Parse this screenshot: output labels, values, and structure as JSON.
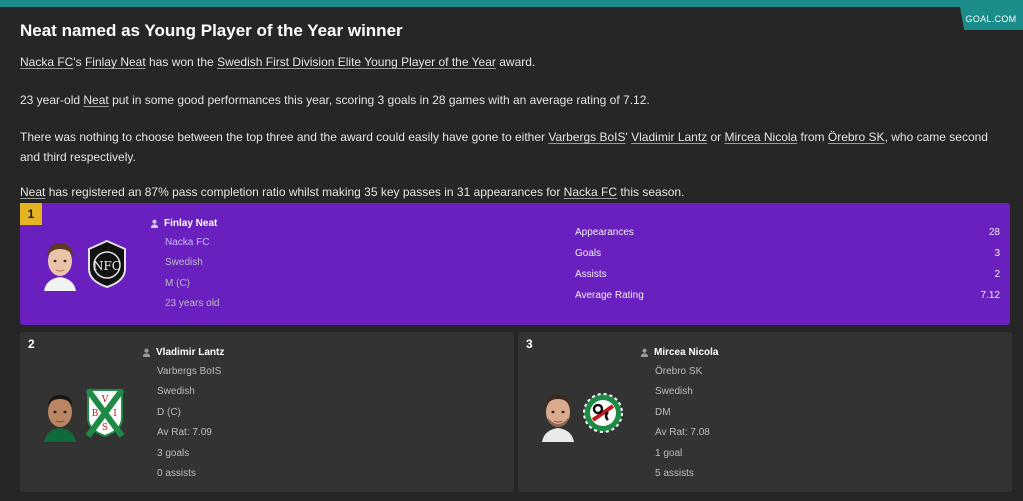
{
  "source_tab": "GOAL.COM",
  "headline": "Neat named as Young Player of the Year winner",
  "p1": {
    "club": "Nacka FC",
    "possessive": "'s ",
    "player": "Finlay Neat",
    "mid": " has won the ",
    "award": "Swedish First Division Elite Young Player of the Year",
    "end": " award."
  },
  "p2": {
    "start": "23 year-old ",
    "player": "Neat",
    "end": " put in some good performances this year, scoring 3 goals in 28 games with an average rating of 7.12."
  },
  "p3": {
    "start": "There was nothing to choose between the top three and the award could easily have gone to either ",
    "club2": "Varbergs BoIS",
    "apos": "' ",
    "player2": "Vladimir Lantz",
    "or": " or ",
    "player3": "Mircea Nicola",
    "from": " from ",
    "club3": "Örebro SK",
    "end": ", who came second and third respectively."
  },
  "p4": {
    "player": "Neat",
    "mid": " has registered an 87% pass completion ratio whilst making 35 key passes in 31 appearances for ",
    "club": "Nacka FC",
    "end": " this season."
  },
  "winner": {
    "rank": "1",
    "name": "Finlay Neat",
    "club": "Nacka FC",
    "nationality": "Swedish",
    "position": "M (C)",
    "age": "23 years old",
    "stats": [
      {
        "label": "Appearances",
        "value": "28"
      },
      {
        "label": "Goals",
        "value": "3"
      },
      {
        "label": "Assists",
        "value": "2"
      },
      {
        "label": "Average Rating",
        "value": "7.12"
      }
    ]
  },
  "second": {
    "rank": "2",
    "name": "Vladimir Lantz",
    "club": "Varbergs BoIS",
    "nationality": "Swedish",
    "position": "D (C)",
    "rating": "Av Rat: 7.09",
    "goals": "3 goals",
    "assists": "0 assists"
  },
  "third": {
    "rank": "3",
    "name": "Mircea Nicola",
    "club": "Örebro SK",
    "nationality": "Swedish",
    "position": "DM",
    "rating": "Av Rat: 7.08",
    "goals": "1 goal",
    "assists": "5 assists"
  },
  "crest_letters": {
    "nacka": "NFC",
    "varbergs_top": "V",
    "varbergs_left": "B",
    "varbergs_right": "I",
    "varbergs_bottom": "S"
  },
  "colors": {
    "accent": "#1a8c8a",
    "winner_bg": "#6a1fbf",
    "badge_gold": "#e6b422",
    "card_bg": "#333333"
  }
}
